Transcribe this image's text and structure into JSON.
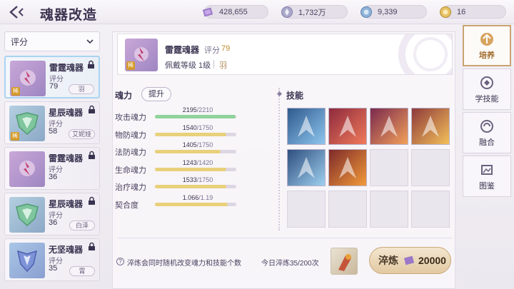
{
  "header": {
    "title": "魂器改造"
  },
  "currencies": [
    {
      "icon": "crystal-icon",
      "value": "428,655"
    },
    {
      "icon": "silver-coin-icon",
      "value": "1,732万"
    },
    {
      "icon": "blue-coin-icon",
      "value": "9,339"
    },
    {
      "icon": "gold-coin-icon",
      "value": "16"
    }
  ],
  "filter": {
    "label": "评分"
  },
  "soul_list": [
    {
      "name": "雷霆魂器",
      "score_label": "评分",
      "score": "79",
      "tag": "羽",
      "locked": true,
      "rare": "稀",
      "selected": true
    },
    {
      "name": "星辰魂器",
      "score_label": "评分",
      "score": "58",
      "tag": "艾妮娅",
      "locked": true,
      "rare": "稀",
      "selected": false
    },
    {
      "name": "雷霆魂器",
      "score_label": "评分",
      "score": "36",
      "tag": "",
      "locked": true,
      "rare": "",
      "selected": false
    },
    {
      "name": "星辰魂器",
      "score_label": "评分",
      "score": "36",
      "tag": "白泽",
      "locked": true,
      "rare": "",
      "selected": false
    },
    {
      "name": "无坚魂器",
      "score_label": "评分",
      "score": "35",
      "tag": "霄",
      "locked": true,
      "rare": "",
      "selected": false
    }
  ],
  "detail": {
    "name": "雷霆魂器",
    "score_label": "评分",
    "score": "79",
    "level": "佩戴等级 1级",
    "owner": "羽",
    "rare": "稀"
  },
  "power_section": {
    "title": "魂力",
    "upgrade_label": "提升"
  },
  "stats": [
    {
      "label": "攻击魂力",
      "current": "2195",
      "max": "/2210",
      "ratio": 0.993,
      "color": "green"
    },
    {
      "label": "物防魂力",
      "current": "1540",
      "max": "/1750",
      "ratio": 0.88,
      "color": "gold"
    },
    {
      "label": "法防魂力",
      "current": "1405",
      "max": "/1750",
      "ratio": 0.803,
      "color": "gold"
    },
    {
      "label": "生命魂力",
      "current": "1243",
      "max": "/1420",
      "ratio": 0.875,
      "color": "gold"
    },
    {
      "label": "治疗魂力",
      "current": "1533",
      "max": "/1750",
      "ratio": 0.876,
      "color": "gold"
    },
    {
      "label": "契合度",
      "current": "1.066",
      "max": "/1.19",
      "ratio": 0.896,
      "color": "gold"
    }
  ],
  "skills_section": {
    "title": "技能"
  },
  "skills": [
    {
      "icon": "ice-shard-skill-icon",
      "filled": true
    },
    {
      "icon": "meteor-strike-skill-icon",
      "filled": true
    },
    {
      "icon": "sword-rain-skill-icon",
      "filled": true
    },
    {
      "icon": "flame-blade-skill-icon",
      "filled": true
    },
    {
      "icon": "ice-shard-plus-skill-icon",
      "filled": true
    },
    {
      "icon": "fire-wolf-skill-icon",
      "filled": true
    },
    {
      "icon": "empty-slot",
      "filled": false
    },
    {
      "icon": "empty-slot",
      "filled": false
    },
    {
      "icon": "empty-slot",
      "filled": false
    },
    {
      "icon": "empty-slot",
      "filled": false
    },
    {
      "icon": "empty-slot",
      "filled": false
    },
    {
      "icon": "empty-slot",
      "filled": false
    }
  ],
  "footer": {
    "hint": "淬炼会同时随机改变魂力和技能个数",
    "today": "今日淬炼35/200次",
    "refine_label": "淬炼",
    "refine_cost": "20000"
  },
  "right_tabs": [
    {
      "label": "培养",
      "icon": "cultivate-icon",
      "active": true
    },
    {
      "label": "学技能",
      "icon": "learn-skill-icon",
      "active": false
    },
    {
      "label": "融合",
      "icon": "fusion-icon",
      "active": false
    },
    {
      "label": "图鉴",
      "icon": "codex-icon",
      "active": false
    }
  ],
  "colors": {
    "accent_gold": "#c9a372",
    "score_gold": "#c08a2a",
    "bar_green": "#8fd39a",
    "bar_gold": "#e9d07a"
  }
}
